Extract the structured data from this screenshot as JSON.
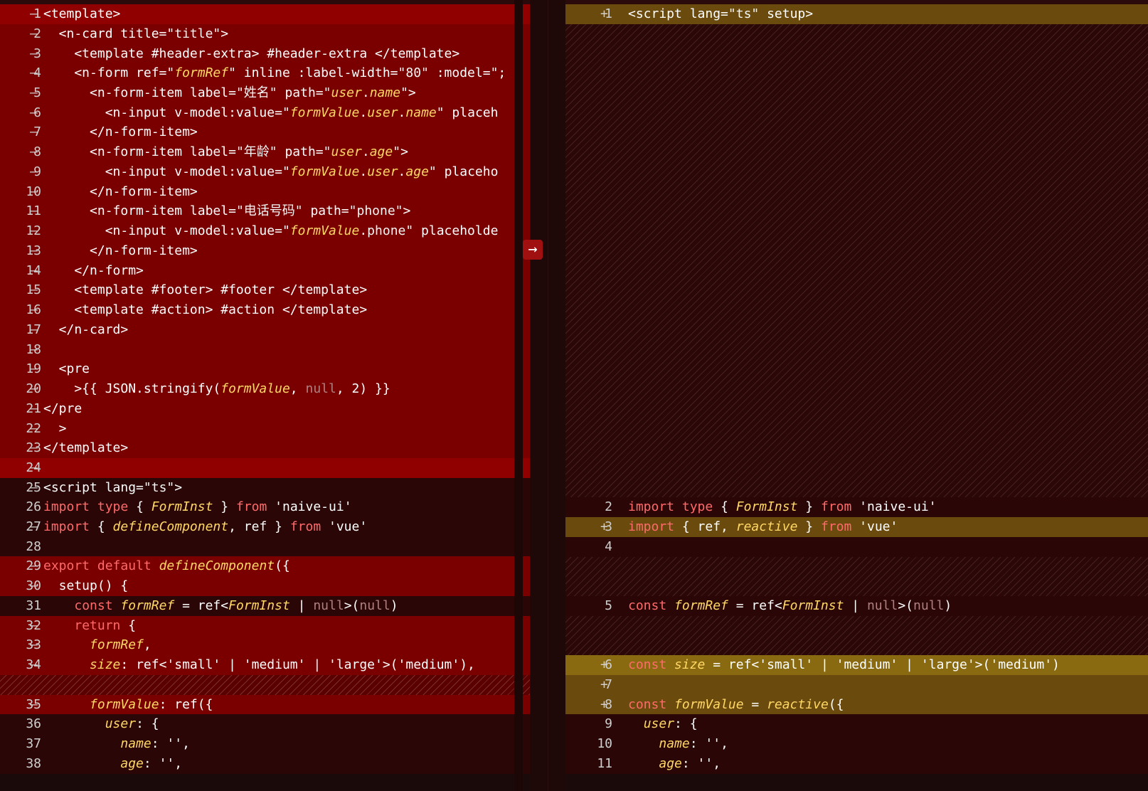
{
  "toolbar": {
    "swap_label": "→"
  },
  "left": {
    "lines": [
      {
        "n": "1",
        "m": "—",
        "t": "<template>"
      },
      {
        "n": "2",
        "m": "—",
        "t": "  <n-card title=\"title\">"
      },
      {
        "n": "3",
        "m": "—",
        "t": "    <template #header-extra> #header-extra </template>"
      },
      {
        "n": "4",
        "m": "—",
        "t": "    <n-form ref=\"formRef\" inline :label-width=\"80\" :model=\";"
      },
      {
        "n": "5",
        "m": "—",
        "t": "      <n-form-item label=\"姓名\" path=\"user.name\">"
      },
      {
        "n": "6",
        "m": "—",
        "t": "        <n-input v-model:value=\"formValue.user.name\" placeh"
      },
      {
        "n": "7",
        "m": "—",
        "t": "      </n-form-item>"
      },
      {
        "n": "8",
        "m": "—",
        "t": "      <n-form-item label=\"年龄\" path=\"user.age\">"
      },
      {
        "n": "9",
        "m": "—",
        "t": "        <n-input v-model:value=\"formValue.user.age\" placeho"
      },
      {
        "n": "10",
        "m": "—",
        "t": "      </n-form-item>"
      },
      {
        "n": "11",
        "m": "—",
        "t": "      <n-form-item label=\"电话号码\" path=\"phone\">"
      },
      {
        "n": "12",
        "m": "—",
        "t": "        <n-input v-model:value=\"formValue.phone\" placeholde"
      },
      {
        "n": "13",
        "m": "—",
        "t": "      </n-form-item>"
      },
      {
        "n": "14",
        "m": "—",
        "t": "    </n-form>"
      },
      {
        "n": "15",
        "m": "—",
        "t": "    <template #footer> #footer </template>"
      },
      {
        "n": "16",
        "m": "—",
        "t": "    <template #action> #action </template>"
      },
      {
        "n": "17",
        "m": "—",
        "t": "  </n-card>"
      },
      {
        "n": "18",
        "m": "—",
        "t": ""
      },
      {
        "n": "19",
        "m": "—",
        "t": "  <pre"
      },
      {
        "n": "20",
        "m": "—",
        "t": "    >{{ JSON.stringify(formValue, null, 2) }}"
      },
      {
        "n": "21",
        "m": "—",
        "t": "</pre"
      },
      {
        "n": "22",
        "m": "—",
        "t": "  >"
      },
      {
        "n": "23",
        "m": "—",
        "t": "</template>"
      },
      {
        "n": "24",
        "m": "—",
        "t": ""
      },
      {
        "n": "25",
        "m": "—",
        "t": "<script lang=\"ts\">"
      },
      {
        "n": "26",
        "m": "",
        "t": "import type { FormInst } from 'naive-ui'"
      },
      {
        "n": "27",
        "m": "—",
        "t": "import { defineComponent, ref } from 'vue'"
      },
      {
        "n": "28",
        "m": "",
        "t": ""
      },
      {
        "n": "29",
        "m": "—",
        "t": "export default defineComponent({"
      },
      {
        "n": "30",
        "m": "—",
        "t": "  setup() {"
      },
      {
        "n": "31",
        "m": "",
        "t": "    const formRef = ref<FormInst | null>(null)"
      },
      {
        "n": "32",
        "m": "—",
        "t": "    return {"
      },
      {
        "n": "33",
        "m": "—",
        "t": "      formRef,"
      },
      {
        "n": "34",
        "m": "—",
        "t": "      size: ref<'small' | 'medium' | 'large'>('medium'),"
      },
      {
        "n": "",
        "m": "",
        "t": ""
      },
      {
        "n": "35",
        "m": "—",
        "t": "      formValue: ref({"
      },
      {
        "n": "36",
        "m": "",
        "t": "        user: {"
      },
      {
        "n": "37",
        "m": "",
        "t": "          name: '',"
      },
      {
        "n": "38",
        "m": "",
        "t": "          age: '',"
      }
    ]
  },
  "right": {
    "lines": [
      {
        "n": "1",
        "m": "+",
        "t": "<script lang=\"ts\" setup>"
      },
      {
        "n": "2",
        "m": "",
        "t": "import type { FormInst } from 'naive-ui'"
      },
      {
        "n": "3",
        "m": "+",
        "t": "import { ref, reactive } from 'vue'"
      },
      {
        "n": "4",
        "m": "",
        "t": ""
      },
      {
        "n": "5",
        "m": "",
        "t": "const formRef = ref<FormInst | null>(null)"
      },
      {
        "n": "6",
        "m": "+",
        "t": "const size = ref<'small' | 'medium' | 'large'>('medium')"
      },
      {
        "n": "7",
        "m": "+",
        "t": ""
      },
      {
        "n": "8",
        "m": "+",
        "t": "const formValue = reactive({"
      },
      {
        "n": "9",
        "m": "",
        "t": "  user: {"
      },
      {
        "n": "10",
        "m": "",
        "t": "    name: '',"
      },
      {
        "n": "11",
        "m": "",
        "t": "    age: '',"
      }
    ]
  }
}
